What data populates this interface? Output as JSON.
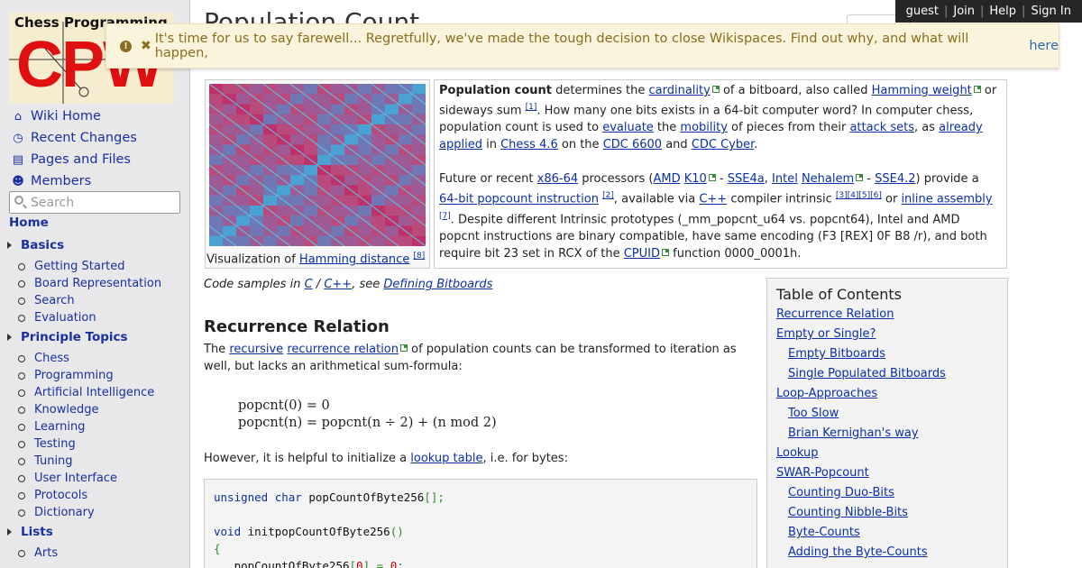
{
  "topbar": [
    "guest",
    "Join",
    "Help",
    "Sign In"
  ],
  "logo": {
    "top": "Chess Programming",
    "big": "CPW"
  },
  "nav_main": [
    {
      "icon": "home-icon",
      "glyph": "⌂",
      "label": "Wiki Home"
    },
    {
      "icon": "clock-icon",
      "glyph": "◷",
      "label": "Recent Changes"
    },
    {
      "icon": "file-icon",
      "glyph": "▤",
      "label": "Pages and Files"
    },
    {
      "icon": "users-icon",
      "glyph": "☻",
      "label": "Members"
    }
  ],
  "search": {
    "placeholder": "Search"
  },
  "home": "Home",
  "sections": [
    {
      "label": "Basics",
      "items": [
        "Getting Started",
        "Board Representation",
        "Search",
        "Evaluation"
      ]
    },
    {
      "label": "Principle Topics",
      "items": [
        "Chess",
        "Programming",
        "Artificial Intelligence",
        "Knowledge",
        "Learning",
        "Testing",
        "Tuning",
        "User Interface",
        "Protocols",
        "Dictionary"
      ]
    },
    {
      "label": "Lists",
      "items": [
        "Arts"
      ]
    }
  ],
  "page_title": "Population Count",
  "alert": {
    "text": "It's time for us to say farewell... Regretfully, we've made the tough decision to close Wikispaces. Find out why, and what will happen,",
    "link": "here"
  },
  "thumb_caption": {
    "text": "Visualization of",
    "link": "Hamming distance",
    "ref": "[8]"
  },
  "intro": {
    "p1": [
      {
        "b": "Population count"
      },
      {
        "t": " determines the "
      },
      {
        "a": "cardinality",
        "ext": true
      },
      {
        "t": " of a bitboard, also called "
      },
      {
        "a": "Hamming weight",
        "ext": true
      },
      {
        "t": " or sideways sum "
      },
      {
        "ref": "[1]"
      },
      {
        "t": ". How many one bits exists in a 64-bit computer word? In computer chess, population count is used to "
      },
      {
        "a": "evaluate"
      },
      {
        "t": " the "
      },
      {
        "a": "mobility"
      },
      {
        "t": " of pieces from their "
      },
      {
        "a": "attack sets"
      },
      {
        "t": ", as "
      },
      {
        "a": "already applied"
      },
      {
        "t": " in "
      },
      {
        "a": "Chess 4.6"
      },
      {
        "t": " on the "
      },
      {
        "a": "CDC 6600"
      },
      {
        "t": " and "
      },
      {
        "a": "CDC Cyber"
      },
      {
        "t": "."
      }
    ],
    "p2": [
      {
        "t": "Future or recent "
      },
      {
        "a": "x86-64"
      },
      {
        "t": " processors ("
      },
      {
        "a": "AMD"
      },
      {
        "t": " "
      },
      {
        "a": "K10",
        "ext": true
      },
      {
        "t": " - "
      },
      {
        "a": "SSE4a"
      },
      {
        "t": ", "
      },
      {
        "a": "Intel"
      },
      {
        "t": " "
      },
      {
        "a": "Nehalem",
        "ext": true
      },
      {
        "t": " - "
      },
      {
        "a": "SSE4.2"
      },
      {
        "t": ") provide a "
      },
      {
        "a": "64-bit popcount instruction"
      },
      {
        "t": " "
      },
      {
        "ref": "[2]"
      },
      {
        "t": ", available via "
      },
      {
        "a": "C++"
      },
      {
        "t": " compiler intrinsic "
      },
      {
        "ref": "[3][4][5][6]"
      },
      {
        "t": " or "
      },
      {
        "a": "inline assembly"
      },
      {
        "t": " "
      },
      {
        "ref": "[7]"
      },
      {
        "t": ". Despite different Intrinsic prototypes (_mm_popcnt_u64 vs. popcnt64), Intel and AMD popcnt instructions are binary compatible, have same encoding (F3 [REX] 0F B8 /r), and both require bit 23 set in RCX of the "
      },
      {
        "a": "CPUID",
        "ext": true
      },
      {
        "t": " function 0000_0001h."
      }
    ]
  },
  "code_samples": [
    {
      "t": "Code samples in "
    },
    {
      "a": "C"
    },
    {
      "t": " / "
    },
    {
      "a": "C++"
    },
    {
      "t": ", see "
    },
    {
      "a": "Defining Bitboards"
    }
  ],
  "recurrence": {
    "heading": "Recurrence Relation",
    "p": [
      {
        "t": "The "
      },
      {
        "a": "recursive"
      },
      {
        "t": " "
      },
      {
        "a": "recurrence relation",
        "ext": true
      },
      {
        "t": " of population counts can be transformed to iteration as well, but lacks an arithmetical sum-formula:"
      }
    ],
    "math1": "popcnt(0) = 0",
    "math2": "popcnt(n) = popcnt(n ÷ 2) + (n  mod 2)",
    "p2": [
      {
        "t": "However, it is helpful to initialize a "
      },
      {
        "a": "lookup table"
      },
      {
        "t": ", i.e. for bytes:"
      }
    ]
  },
  "code": {
    "line1": [
      "unsigned char",
      " popCountOfByte256",
      "[];"
    ],
    "line2": [
      "void",
      " initpopCountOfByte256",
      "()"
    ],
    "line3": "{",
    "line4": [
      "   popCountOfByte256",
      "[",
      "0",
      "] = ",
      "0",
      ";"
    ]
  },
  "toc": {
    "title": "Table of Contents",
    "items": [
      {
        "label": "Recurrence Relation",
        "level": 1
      },
      {
        "label": "Empty or Single?",
        "level": 1
      },
      {
        "label": "Empty Bitboards",
        "level": 2
      },
      {
        "label": "Single Populated Bitboards",
        "level": 2
      },
      {
        "label": "Loop-Approaches",
        "level": 1
      },
      {
        "label": "Too Slow",
        "level": 2
      },
      {
        "label": "Brian Kernighan's way",
        "level": 2
      },
      {
        "label": "Lookup",
        "level": 1
      },
      {
        "label": "SWAR-Popcount",
        "level": 1
      },
      {
        "label": "Counting Duo-Bits",
        "level": 2
      },
      {
        "label": "Counting Nibble-Bits",
        "level": 2
      },
      {
        "label": "Byte-Counts",
        "level": 2
      },
      {
        "label": "Adding the Byte-Counts",
        "level": 2
      }
    ]
  }
}
